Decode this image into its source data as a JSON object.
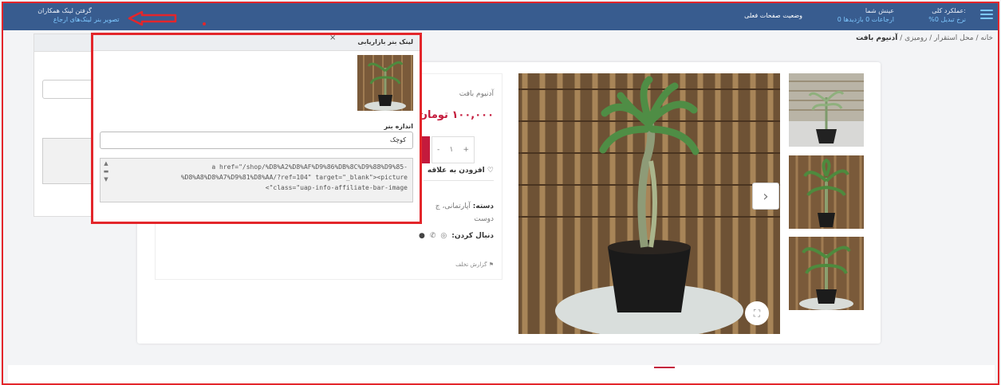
{
  "topbar": {
    "overall_label": ":عملکرد کلی",
    "overall_value": "نرخ تبدیل 0%",
    "earnings_label": "عینش شما",
    "earnings_value": "ارجاعات 0  بازدیدها 0",
    "current_status": "وضعیت صفحات فعلی",
    "get_link_title": "گرفتن لینک همکاران",
    "referral_links": "لینک‌های ارجاع",
    "banner_image": "تصویر بنر",
    "accent_color": "#385c8f"
  },
  "breadcrumb": {
    "home": "خانه",
    "placement": "محل استقرار",
    "tabletop": "رومیزی",
    "current": "آدنیوم بافت",
    "sep": " / "
  },
  "product": {
    "name": "آدنیوم بافت",
    "price": "۱۰۰,۰۰۰ تومان",
    "qty": "۱",
    "plus": "+",
    "minus": "-",
    "wishlist": "افزودن به علاقه",
    "category_label": "دسته:",
    "category_value": "آپارتمانی، ج",
    "category_cont": "دوست",
    "follow_label": "دنبال کردن:",
    "report": "گزارش تخلف",
    "next": "›",
    "zoom": "⛶"
  },
  "popup": {
    "title": "لینک بنر بازاریابی",
    "close": "×",
    "size_label": "اندازه بنر",
    "size_value": "کوچک",
    "code_line1": "a href=\"/shop/%D8%A2%D8%AF%D9%86%DB%8C%D9%88%D9%85-",
    "code_line2": "%D8%A8%D8%A7%D9%81%D8%AA/?ref=104\" target=\"_blank\"><picture",
    "code_line3": "<\"class=\"uap-info-affiliate-bar-image"
  }
}
